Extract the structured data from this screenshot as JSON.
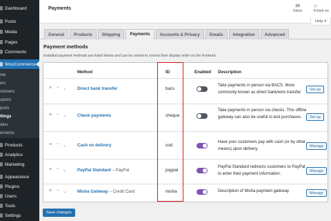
{
  "sidebar": {
    "items": [
      {
        "label": "Dashboard"
      },
      {
        "label": "Posts"
      },
      {
        "label": "Media"
      },
      {
        "label": "Pages"
      },
      {
        "label": "Comments"
      },
      {
        "label": "WooCommerce"
      },
      {
        "label": "Products"
      },
      {
        "label": "Analytics"
      },
      {
        "label": "Marketing"
      },
      {
        "label": "Appearance"
      },
      {
        "label": "Plugins"
      },
      {
        "label": "Users"
      },
      {
        "label": "Tools"
      },
      {
        "label": "Settings"
      }
    ],
    "submenu": [
      {
        "label": "me"
      },
      {
        "label": "ers"
      },
      {
        "label": "stomers"
      },
      {
        "label": "upons"
      },
      {
        "label": "ports"
      },
      {
        "label": "ttings"
      },
      {
        "label": "atus"
      },
      {
        "label": "ensions"
      }
    ]
  },
  "header": {
    "title": "Payments",
    "inbox_label": "Inbox",
    "finish_label": "Finish se",
    "help_label": "Help"
  },
  "tabs": [
    {
      "label": "General"
    },
    {
      "label": "Products"
    },
    {
      "label": "Shipping"
    },
    {
      "label": "Payments"
    },
    {
      "label": "Accounts & Privacy"
    },
    {
      "label": "Emails"
    },
    {
      "label": "Integration"
    },
    {
      "label": "Advanced"
    }
  ],
  "section": {
    "title": "Payment methods",
    "description": "Installed payment methods are listed below and can be sorted to control their display order on the frontend."
  },
  "table": {
    "headers": {
      "method": "Method",
      "id": "ID",
      "enabled": "Enabled",
      "description": "Description"
    },
    "rows": [
      {
        "name": "Direct bank transfer",
        "sub": "",
        "id": "bacs",
        "enabled": false,
        "description": "Take payments in person via BACS. More commonly known as direct bank/wire transfer.",
        "action": "Set up"
      },
      {
        "name": "Check payments",
        "sub": "",
        "id": "cheque",
        "enabled": false,
        "description": "Take payments in person via checks. This offline gateway can also be useful to test purchases.",
        "action": "Set up"
      },
      {
        "name": "Cash on delivery",
        "sub": "",
        "id": "cod",
        "enabled": true,
        "description": "Have your customers pay with cash (or by other means) upon delivery.",
        "action": "Manage"
      },
      {
        "name": "PayPal Standard",
        "sub": " – PayPal",
        "id": "paypal",
        "enabled": true,
        "description": "PayPal Standard redirects customers to PayPal to enter their payment information.",
        "action": "Manage"
      },
      {
        "name": "Misha Gateway",
        "sub": " – Credit Card",
        "id": "misha",
        "enabled": true,
        "description": "Description of Misha payment gateway",
        "action": "Manage"
      }
    ]
  },
  "footer": {
    "save_label": "Save changes"
  },
  "colors": {
    "accent": "#2271b1",
    "toggle_on": "#7f54b3",
    "highlight": "#e0101a",
    "sidebar_bg": "#1d2327"
  }
}
